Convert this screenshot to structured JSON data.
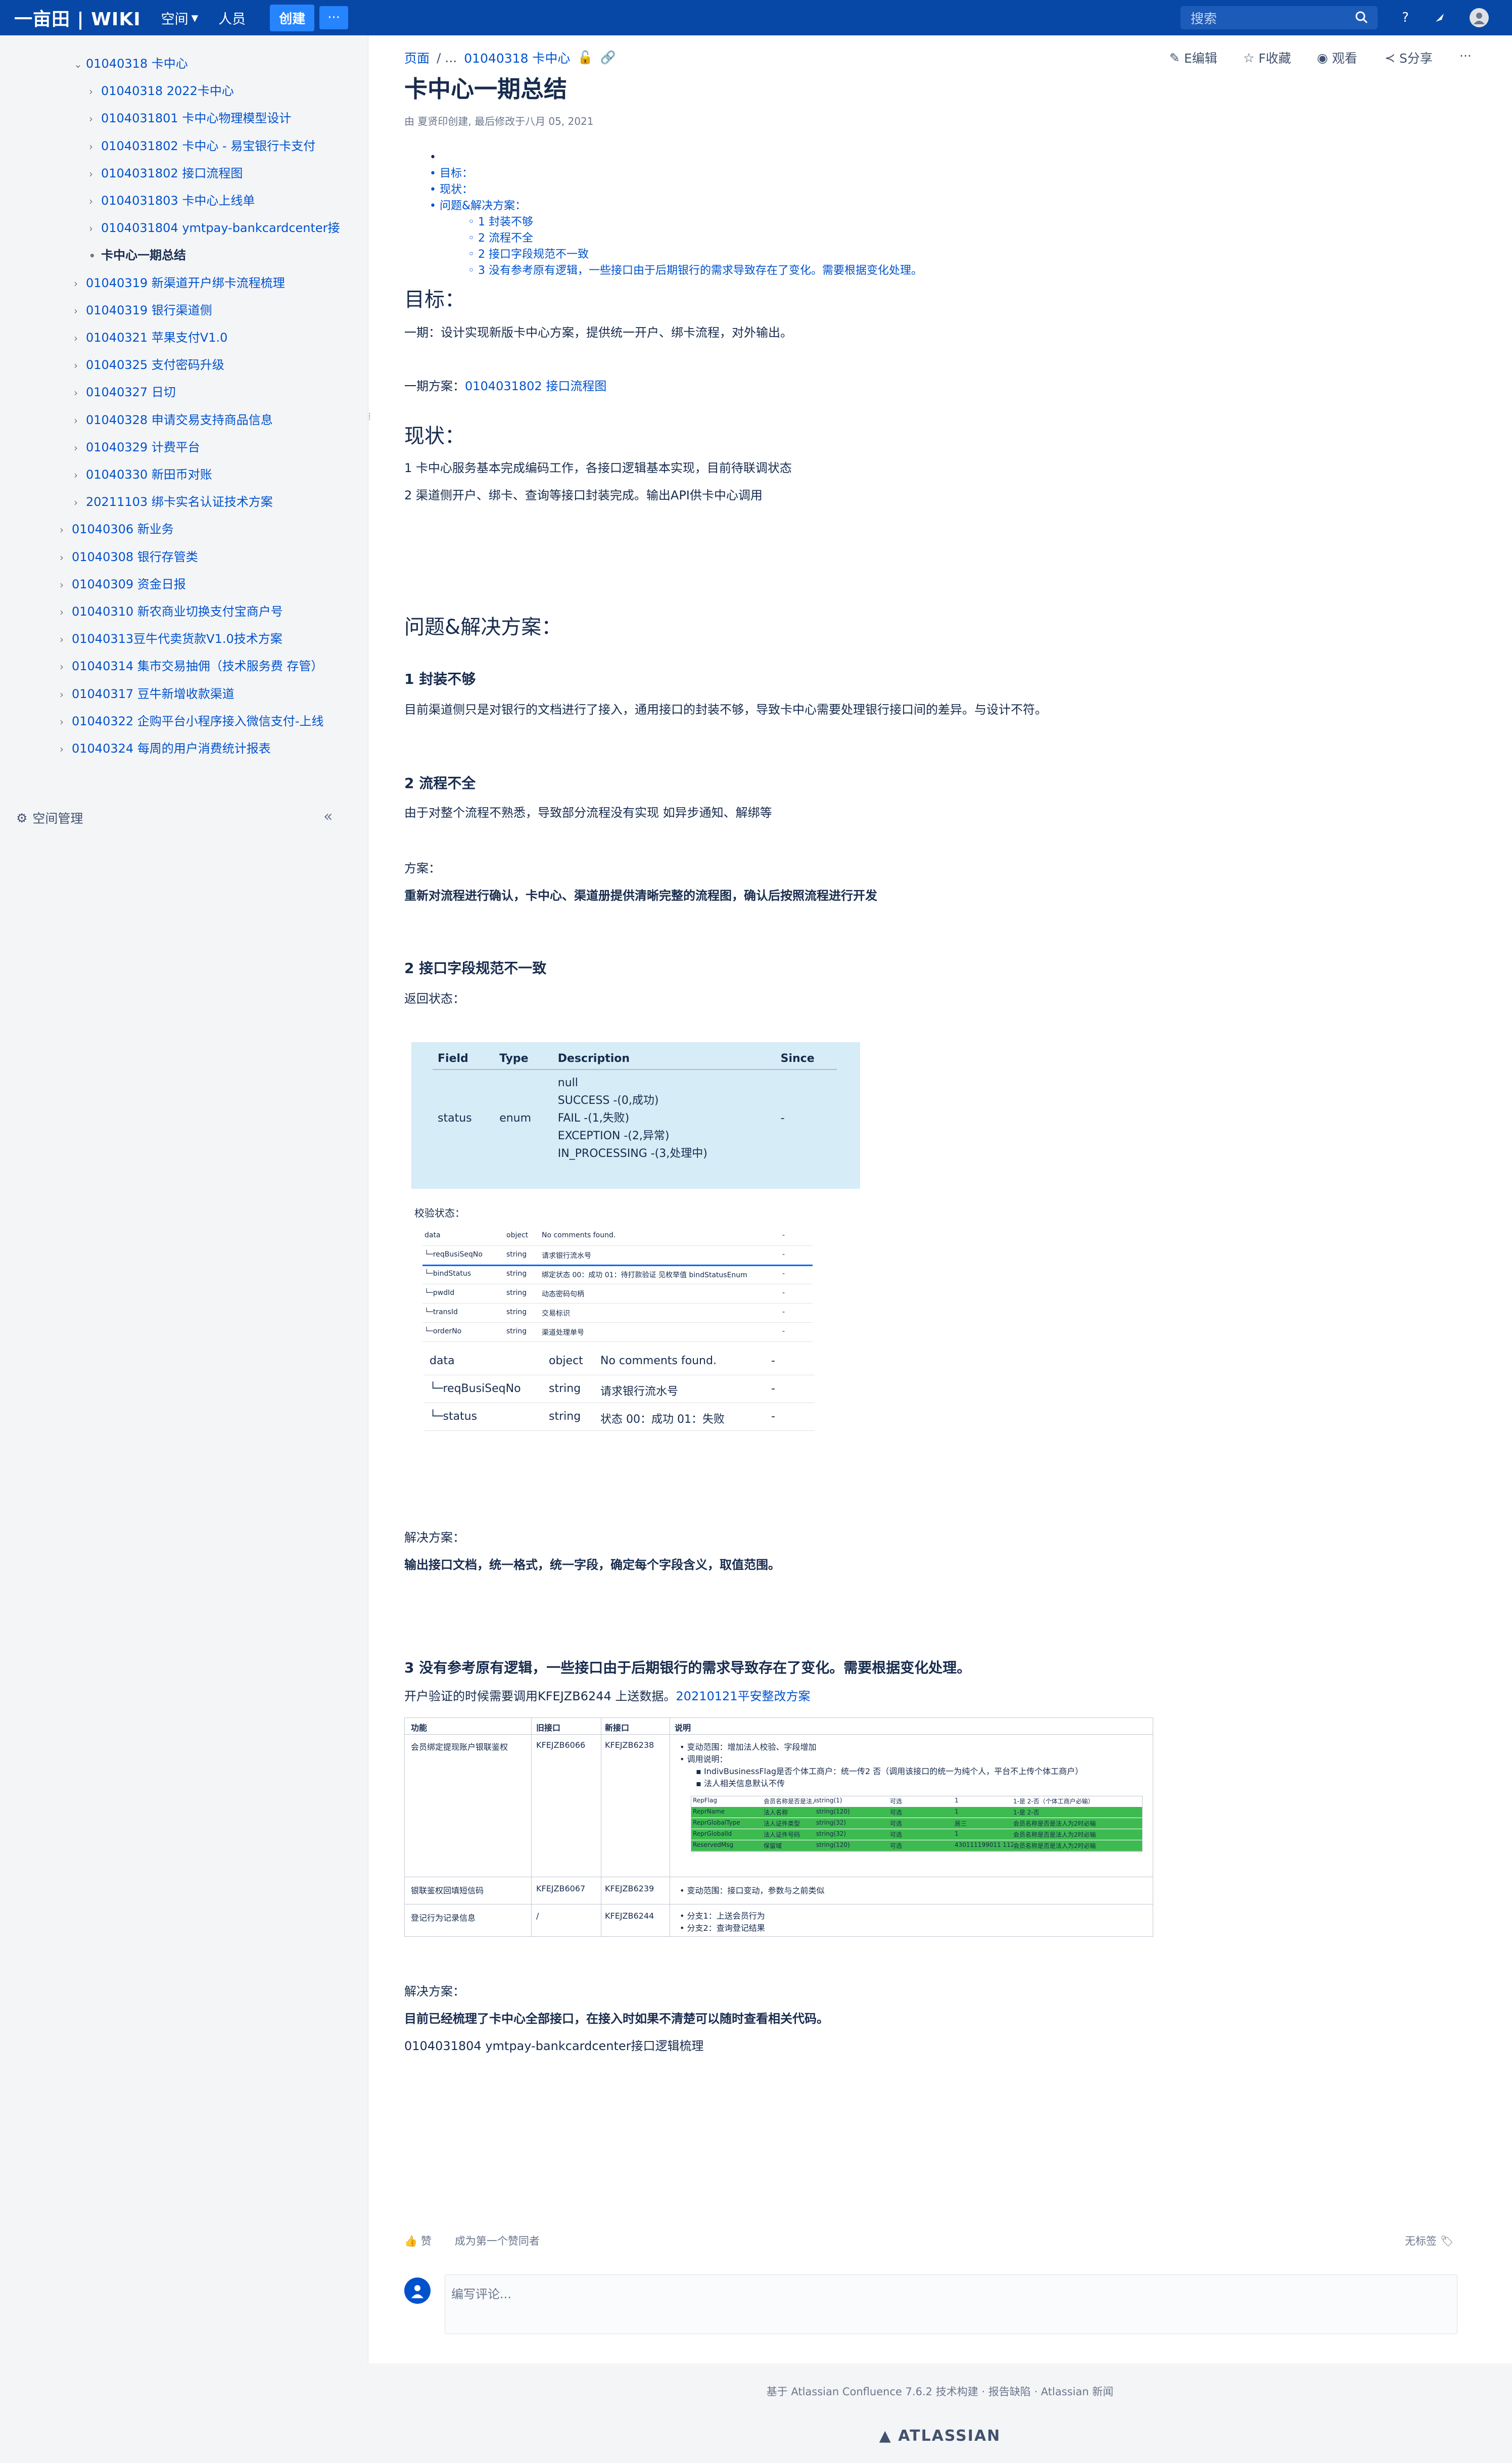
{
  "topnav": {
    "brand": "一亩田 | WIKI",
    "spaces": "空间",
    "people": "人员",
    "create": "创建",
    "more": "···",
    "search_placeholder": "搜索",
    "icons": [
      "search-icon",
      "help-icon",
      "notification-icon",
      "avatar"
    ]
  },
  "sidebar": {
    "items": [
      {
        "label": "01040318 卡中心",
        "level": 1,
        "expanded": true
      },
      {
        "label": "01040318 2022卡中心",
        "level": 2
      },
      {
        "label": "0104031801 卡中心物理模型设计",
        "level": 2
      },
      {
        "label": "0104031802 卡中心 - 易宝银行卡支付",
        "level": 2
      },
      {
        "label": "0104031802 接口流程图",
        "level": 2
      },
      {
        "label": "0104031803 卡中心上线单",
        "level": 2
      },
      {
        "label": "0104031804 ymtpay-bankcardcenter接",
        "level": 2
      },
      {
        "label": "卡中心一期总结",
        "level": 2,
        "current": true
      },
      {
        "label": "01040319 新渠道开户绑卡流程梳理",
        "level": 1
      },
      {
        "label": "01040319 银行渠道侧",
        "level": 1
      },
      {
        "label": "01040321 苹果支付V1.0",
        "level": 1
      },
      {
        "label": "01040325 支付密码升级",
        "level": 1
      },
      {
        "label": "01040327 日切",
        "level": 1
      },
      {
        "label": "01040328 申请交易支持商品信息",
        "level": 1
      },
      {
        "label": "01040329 计费平台",
        "level": 1
      },
      {
        "label": "01040330 新田币对账",
        "level": 1
      },
      {
        "label": "20211103 绑卡实名认证技术方案",
        "level": 1
      },
      {
        "label": "01040306 新业务",
        "level": 0
      },
      {
        "label": "01040308 银行存管类",
        "level": 0
      },
      {
        "label": "01040309 资金日报",
        "level": 0
      },
      {
        "label": "01040310 新农商业切换支付宝商户号",
        "level": 0
      },
      {
        "label": "01040313豆牛代卖货款V1.0技术方案",
        "level": 0
      },
      {
        "label": "01040314 集市交易抽佣（技术服务费 存管）",
        "level": 0
      },
      {
        "label": "01040317 豆牛新增收款渠道",
        "level": 0
      },
      {
        "label": "01040322 企购平台小程序接入微信支付-上线",
        "level": 0
      },
      {
        "label": "01040324 每周的用户消费统计报表",
        "level": 0
      }
    ],
    "space_mgmt": "空间管理",
    "collapse": "«"
  },
  "breadcrumb": {
    "root": "页面",
    "sep": "/ ...",
    "parent": "01040318 卡中心"
  },
  "page_actions": {
    "edit": "E编辑",
    "star": "F收藏",
    "watch": "观看",
    "share": "S分享",
    "more": "···"
  },
  "page": {
    "title": "卡中心一期总结",
    "byline": "由 夏贤印创建, 最后修改于八月 05, 2021",
    "toc": [
      "目标：",
      "现状：",
      "问题&解决方案：",
      "1 封装不够",
      "2 流程不全",
      "2 接口字段规范不一致",
      "3 没有参考原有逻辑，一些接口由于后期银行的需求导致存在了变化。需要根据变化处理。"
    ],
    "sec_goal": "目标：",
    "goal_p1": "一期：设计实现新版卡中心方案，提供统一开户、绑卡流程，对外输出。",
    "goal_p2_prefix": "一期方案：",
    "goal_p2_link": "0104031802 接口流程图",
    "sec_status": "现状：",
    "status_p1": "1 卡中心服务基本完成编码工作，各接口逻辑基本实现，目前待联调状态",
    "status_p2": "2 渠道侧开户、绑卡、查询等接口封装完成。输出API供卡中心调用",
    "sec_problem": "问题&解决方案：",
    "p1_title": "1 封装不够",
    "p1_text": "目前渠道侧只是对银行的文档进行了接入，通用接口的封装不够，导致卡中心需要处理银行接口间的差异。与设计不符。",
    "p2_title": "2 流程不全",
    "p2_text": "由于对整个流程不熟悉，导致部分流程没有实现 如异步通知、解绑等",
    "p2_plan_label": "方案：",
    "p2_plan": "重新对流程进行确认，卡中心、渠道册提供清晰完整的流程图，确认后按照流程进行开发",
    "p3_title": "2 接口字段规范不一致",
    "p3_label": "返回状态：",
    "ret_table": {
      "headers": [
        "Field",
        "Type",
        "Description",
        "Since"
      ],
      "row": {
        "field": "status",
        "type": "enum",
        "desc": [
          "null",
          "SUCCESS -(0,成功)",
          "FAIL -(1,失败)",
          "EXCEPTION -(2,异常)",
          "IN_PROCESSING -(3,处理中)"
        ],
        "since": "-"
      }
    },
    "verify_label": "校验状态：",
    "mini_rows": [
      {
        "f": "data",
        "t": "object",
        "d": "No comments found.",
        "s": "-"
      },
      {
        "f": "└─reqBusiSeqNo",
        "t": "string",
        "d": "请求银行流水号",
        "s": "-"
      },
      {
        "f": "└─bindStatus",
        "t": "string",
        "d": "绑定状态 00：成功 01：待打款验证 见枚举值 bindStatusEnum",
        "s": "-"
      },
      {
        "f": "└─pwdId",
        "t": "string",
        "d": "动态密码句柄",
        "s": "-"
      },
      {
        "f": "└─transId",
        "t": "string",
        "d": "交易标识",
        "s": "-"
      },
      {
        "f": "└─orderNo",
        "t": "string",
        "d": "渠道处理单号",
        "s": "-"
      }
    ],
    "big_rows": [
      {
        "f": "data",
        "t": "object",
        "d": "No comments found.",
        "s": "-"
      },
      {
        "f": "└─reqBusiSeqNo",
        "t": "string",
        "d": "请求银行流水号",
        "s": "-"
      },
      {
        "f": "└─status",
        "t": "string",
        "d": "状态 00：成功 01：失败",
        "s": "-"
      }
    ],
    "p3_plan_label": "解决方案：",
    "p3_plan": "输出接口文档，统一格式，统一字段，确定每个字段含义，取值范围。",
    "p4_title": "3 没有参考原有逻辑，一些接口由于后期银行的需求导致存在了变化。需要根据变化处理。",
    "p4_text_prefix": "开户验证的时候需要调用KFEJZB6244 上送数据。",
    "p4_link": "20210121平安整改方案",
    "itable": {
      "headers": [
        "功能",
        "旧接口",
        "新接口",
        "说明"
      ],
      "rows": [
        {
          "func": "会员绑定提现账户银联鉴权",
          "old": "KFEJZB6066",
          "new": "KFEJZB6238",
          "notes": [
            "变动范围：增加法人校验、字段增加",
            "调用说明：",
            "IndivBusinessFlag是否个体工商户：统一传2 否（调用该接口的统一为纯个人，平台不上传个体工商户）",
            "法人相关信息默认不传"
          ]
        },
        {
          "func": "银联鉴权回填短信码",
          "old": "KFEJZB6067",
          "new": "KFEJZB6239",
          "notes": [
            "变动范围：接口变动，参数与之前类似"
          ]
        },
        {
          "func": "登记行为记录信息",
          "old": "/",
          "new": "KFEJZB6244",
          "notes": [
            "分支1：上送会员行为",
            "分支2：查询登记结果"
          ]
        }
      ],
      "inner": [
        [
          "RepFlag",
          "会员名称是否是法人",
          "string(1)",
          "可选",
          "1",
          "1-是 2-否（个体工商户必输）"
        ],
        [
          "ReprName",
          "法人名称",
          "string(120)",
          "可选",
          "1",
          "1-是 2-否"
        ],
        [
          "ReprGlobalType",
          "法人证件类型",
          "string(32)",
          "可选",
          "居三",
          "会员名称是否是法人为2时必输"
        ],
        [
          "ReprGlobalId",
          "法人证件号码",
          "string(32)",
          "可选",
          "1",
          "会员名称是否是法人为2时必输"
        ],
        [
          "ReservedMsg",
          "保留域",
          "string(120)",
          "可选",
          "430111199011 112866",
          "会员名称是否是法人为2时必输"
        ]
      ]
    },
    "p4_plan_label": "解决方案：",
    "p4_plan": "目前已经梳理了卡中心全部接口，在接入时如果不清楚可以随时查看相关代码。",
    "p4_link2": "0104031804 ymtpay-bankcardcenter接口逻辑梳理"
  },
  "likes": {
    "like": "赞",
    "first": "成为第一个赞同者",
    "no_label": "无标签"
  },
  "comment": {
    "placeholder": "编写评论..."
  },
  "footer": {
    "built": "基于 Atlassian Confluence 7.6.2 技术构建",
    "report": "报告缺陷",
    "news": "Atlassian 新闻",
    "logo": "ATLASSIAN"
  },
  "colors": {
    "topnav": "#0747a6",
    "link": "#0052cc",
    "table_bg": "#d6ecf6",
    "green": "#3dbb50"
  }
}
